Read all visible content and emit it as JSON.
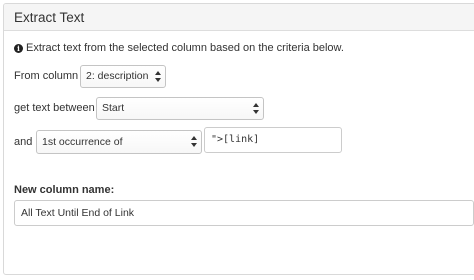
{
  "dialog": {
    "title": "Extract Text",
    "intro": "Extract text from the selected column based on the criteria below.",
    "info_icon": "info-circle-icon"
  },
  "form": {
    "from_column": {
      "label": "From column",
      "value": "2: description"
    },
    "text_between": {
      "label": "get text between",
      "value": "Start"
    },
    "and": {
      "label": "and",
      "occurrence_value": "1st occurrence of",
      "pattern_value": "\">[link]"
    },
    "new_column": {
      "label": "New column name:",
      "value": "All Text Until End of Link"
    }
  }
}
